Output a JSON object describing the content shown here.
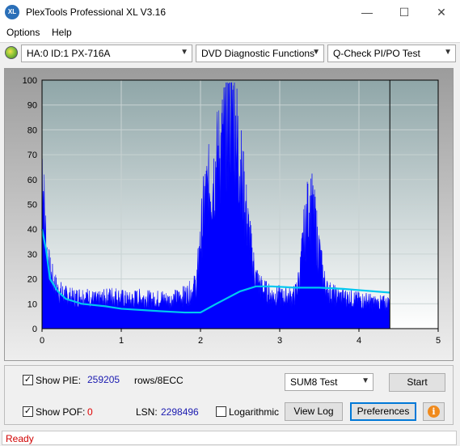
{
  "window": {
    "title": "PlexTools Professional XL V3.16",
    "app_icon_text": "XL",
    "min_glyph": "—",
    "max_glyph": "☐",
    "close_glyph": "✕"
  },
  "menu": {
    "items": [
      "Options",
      "Help"
    ]
  },
  "toolbar": {
    "drive": "HA:0 ID:1  PX-716A",
    "function": "DVD Diagnostic Functions",
    "test": "Q-Check PI/PO Test",
    "arrow": "▼"
  },
  "colors": {
    "pie": "#0000ff",
    "sum8": "#00c8f0",
    "plot_bg_top": "#8fa6a8",
    "plot_bg_bottom": "#ffffff",
    "pie_value": "#1a1ab0",
    "poe_value": "#e00000",
    "status": "#d00000"
  },
  "chart_data": {
    "type": "area",
    "x_ticks": [
      "0",
      "1",
      "2",
      "3",
      "4",
      "5"
    ],
    "y_ticks": [
      "0",
      "10",
      "20",
      "30",
      "40",
      "50",
      "60",
      "70",
      "80",
      "90",
      "100"
    ],
    "xlim": [
      0,
      5
    ],
    "ylim": [
      0,
      100
    ],
    "grid": true,
    "scan_end": 4.39,
    "series": [
      {
        "type": "area",
        "x": [
          0.0,
          0.02,
          0.04,
          0.06,
          0.08,
          0.1,
          0.15,
          0.2,
          0.25,
          0.3,
          0.4,
          0.5,
          0.6,
          0.7,
          0.8,
          0.9,
          1.0,
          1.1,
          1.2,
          1.3,
          1.4,
          1.5,
          1.6,
          1.7,
          1.8,
          1.9,
          1.95,
          2.0,
          2.05,
          2.1,
          2.15,
          2.2,
          2.25,
          2.3,
          2.35,
          2.4,
          2.45,
          2.5,
          2.55,
          2.6,
          2.65,
          2.7,
          2.75,
          2.8,
          2.85,
          2.9,
          2.95,
          3.0,
          3.05,
          3.1,
          3.15,
          3.2,
          3.25,
          3.3,
          3.35,
          3.4,
          3.45,
          3.5,
          3.55,
          3.6,
          3.65,
          3.7,
          3.8,
          3.9,
          4.0,
          4.1,
          4.2,
          4.3,
          4.39
        ],
        "values": [
          68,
          55,
          40,
          30,
          26,
          22,
          18,
          15,
          14,
          13,
          12,
          13,
          12,
          11,
          12,
          13,
          12,
          11,
          12,
          12,
          11,
          12,
          11,
          12,
          13,
          15,
          18,
          35,
          50,
          55,
          58,
          65,
          70,
          76,
          82,
          87,
          78,
          65,
          52,
          40,
          28,
          20,
          17,
          15,
          14,
          13,
          13,
          13,
          12,
          13,
          12,
          14,
          20,
          35,
          45,
          48,
          40,
          30,
          20,
          15,
          14,
          13,
          12,
          12,
          11,
          11,
          10,
          10,
          10
        ]
      },
      {
        "type": "line",
        "x": [
          0.0,
          0.05,
          0.1,
          0.2,
          0.3,
          0.5,
          0.8,
          1.0,
          1.5,
          1.8,
          2.0,
          2.2,
          2.5,
          2.7,
          2.9,
          3.2,
          3.5,
          3.8,
          4.0,
          4.39
        ],
        "values": [
          40,
          32,
          20,
          15,
          12,
          10,
          9,
          8,
          7,
          6.5,
          6.5,
          10,
          15,
          17,
          17,
          16.5,
          16.5,
          16,
          15.5,
          14.5
        ]
      }
    ]
  },
  "controls": {
    "show_pie_label": "Show PIE:",
    "pie_value": "259205",
    "pie_unit": "rows/8ECC",
    "show_poe_label": "Show POF:",
    "poe_value": "0",
    "lsn_label": "LSN:",
    "lsn_value": "2298496",
    "logarithmic_label": "Logarithmic",
    "sum8_select": "SUM8 Test",
    "start_button": "Start",
    "view_log_button": "View Log",
    "preferences_button": "Preferences",
    "check_glyph": "✓",
    "info_glyph": "i"
  },
  "status": {
    "text": "Ready"
  }
}
